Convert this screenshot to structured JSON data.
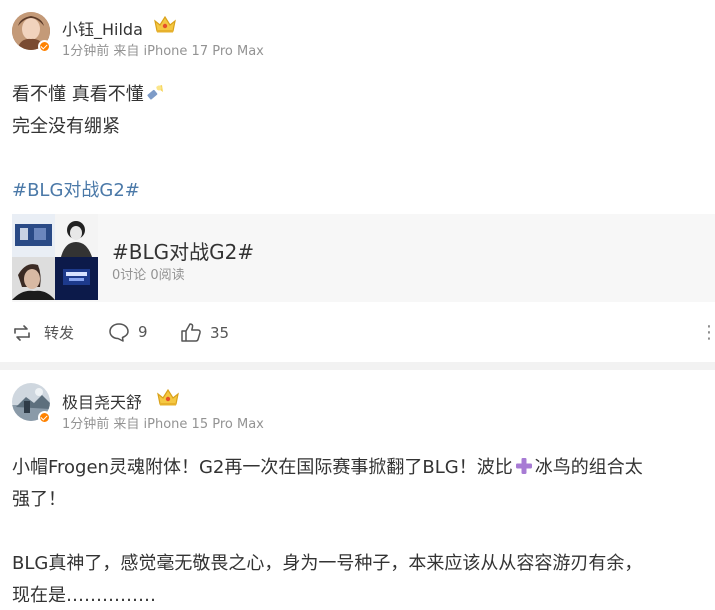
{
  "posts": [
    {
      "username": "小钰_Hilda",
      "meta": "1分钟前 来自 iPhone 17 Pro Max",
      "lines": [
        "看不懂 真看不懂",
        "完全没有绷紧"
      ],
      "hashtag": "#BLG对战G2#",
      "topic_card": {
        "title": "#BLG对战G2#",
        "subtitle": "0讨论 0阅读"
      },
      "actions": {
        "repost_label": "转发",
        "comment_count": "9",
        "like_count": "35"
      },
      "icons": [
        "avatar",
        "verified-badge-icon",
        "crown-icon",
        "flashlight-emoji-icon",
        "repost-icon",
        "comment-icon",
        "like-icon",
        "more-icon"
      ]
    },
    {
      "username": "极目尧天舒",
      "meta": "1分钟前 来自 iPhone 15 Pro Max",
      "lines": [
        "小帽Frogen灵魂附体！G2再一次在国际赛事掀翻了BLG！波比",
        "冰鸟的组合太",
        "强了！",
        "BLG真神了，感觉毫无敬畏之心，身为一号种子，本来应该从从容容游刃有余，",
        "现在是……………"
      ]
    }
  ],
  "colors": {
    "hashtag": "#4b79a8",
    "meta": "#939393",
    "vip_badge": "#ff8200",
    "separator": "#f2f2f2",
    "plus_emoji": "#a77bd4"
  }
}
